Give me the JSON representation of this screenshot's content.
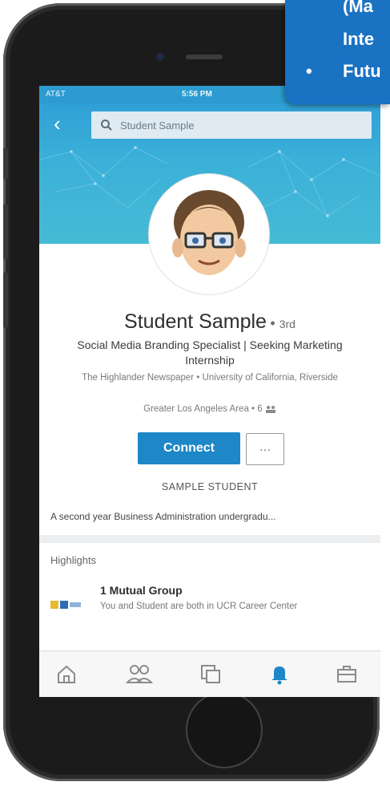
{
  "status": {
    "carrier": "AT&T",
    "time": "5:56 PM"
  },
  "search": {
    "value": "Student Sample"
  },
  "profile": {
    "name": "Student Sample",
    "degree": "3rd",
    "headline": "Social Media Branding Specialist | Seeking Marketing Internship",
    "company": "The Highlander Newspaper • University of California, Riverside",
    "location": "Greater Los Angeles Area • 6",
    "connect_label": "Connect",
    "more_label": "···",
    "sample_label": "SAMPLE STUDENT",
    "summary": "A second year Business Administration undergradu..."
  },
  "highlights": {
    "title": "Highlights",
    "group_title": "1 Mutual Group",
    "group_desc": "You and Student are both in UCR Career Center"
  },
  "tabs": [
    "home-icon",
    "my-network-icon",
    "messaging-icon",
    "notifications-icon",
    "jobs-icon"
  ],
  "callout": {
    "line1": "(Ma",
    "line2": "Inte",
    "bullet": "•",
    "line3": "Futu"
  },
  "colors": {
    "brand": "#1d87c7",
    "banner": "#2fa0d6",
    "callout": "#1a72c2"
  }
}
